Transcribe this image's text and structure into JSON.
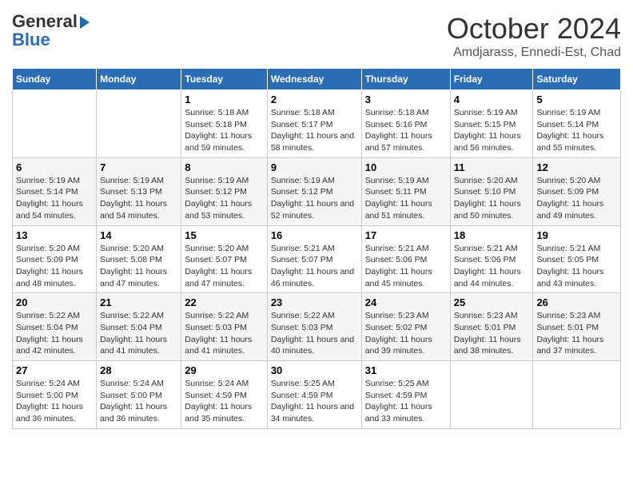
{
  "header": {
    "logo_line1": "General",
    "logo_line2": "Blue",
    "title": "October 2024",
    "subtitle": "Amdjarass, Ennedi-Est, Chad"
  },
  "calendar": {
    "headers": [
      "Sunday",
      "Monday",
      "Tuesday",
      "Wednesday",
      "Thursday",
      "Friday",
      "Saturday"
    ],
    "weeks": [
      [
        {
          "day": "",
          "detail": ""
        },
        {
          "day": "",
          "detail": ""
        },
        {
          "day": "1",
          "detail": "Sunrise: 5:18 AM\nSunset: 5:18 PM\nDaylight: 11 hours and 59 minutes."
        },
        {
          "day": "2",
          "detail": "Sunrise: 5:18 AM\nSunset: 5:17 PM\nDaylight: 11 hours and 58 minutes."
        },
        {
          "day": "3",
          "detail": "Sunrise: 5:18 AM\nSunset: 5:16 PM\nDaylight: 11 hours and 57 minutes."
        },
        {
          "day": "4",
          "detail": "Sunrise: 5:19 AM\nSunset: 5:15 PM\nDaylight: 11 hours and 56 minutes."
        },
        {
          "day": "5",
          "detail": "Sunrise: 5:19 AM\nSunset: 5:14 PM\nDaylight: 11 hours and 55 minutes."
        }
      ],
      [
        {
          "day": "6",
          "detail": "Sunrise: 5:19 AM\nSunset: 5:14 PM\nDaylight: 11 hours and 54 minutes."
        },
        {
          "day": "7",
          "detail": "Sunrise: 5:19 AM\nSunset: 5:13 PM\nDaylight: 11 hours and 54 minutes."
        },
        {
          "day": "8",
          "detail": "Sunrise: 5:19 AM\nSunset: 5:12 PM\nDaylight: 11 hours and 53 minutes."
        },
        {
          "day": "9",
          "detail": "Sunrise: 5:19 AM\nSunset: 5:12 PM\nDaylight: 11 hours and 52 minutes."
        },
        {
          "day": "10",
          "detail": "Sunrise: 5:19 AM\nSunset: 5:11 PM\nDaylight: 11 hours and 51 minutes."
        },
        {
          "day": "11",
          "detail": "Sunrise: 5:20 AM\nSunset: 5:10 PM\nDaylight: 11 hours and 50 minutes."
        },
        {
          "day": "12",
          "detail": "Sunrise: 5:20 AM\nSunset: 5:09 PM\nDaylight: 11 hours and 49 minutes."
        }
      ],
      [
        {
          "day": "13",
          "detail": "Sunrise: 5:20 AM\nSunset: 5:09 PM\nDaylight: 11 hours and 48 minutes."
        },
        {
          "day": "14",
          "detail": "Sunrise: 5:20 AM\nSunset: 5:08 PM\nDaylight: 11 hours and 47 minutes."
        },
        {
          "day": "15",
          "detail": "Sunrise: 5:20 AM\nSunset: 5:07 PM\nDaylight: 11 hours and 47 minutes."
        },
        {
          "day": "16",
          "detail": "Sunrise: 5:21 AM\nSunset: 5:07 PM\nDaylight: 11 hours and 46 minutes."
        },
        {
          "day": "17",
          "detail": "Sunrise: 5:21 AM\nSunset: 5:06 PM\nDaylight: 11 hours and 45 minutes."
        },
        {
          "day": "18",
          "detail": "Sunrise: 5:21 AM\nSunset: 5:06 PM\nDaylight: 11 hours and 44 minutes."
        },
        {
          "day": "19",
          "detail": "Sunrise: 5:21 AM\nSunset: 5:05 PM\nDaylight: 11 hours and 43 minutes."
        }
      ],
      [
        {
          "day": "20",
          "detail": "Sunrise: 5:22 AM\nSunset: 5:04 PM\nDaylight: 11 hours and 42 minutes."
        },
        {
          "day": "21",
          "detail": "Sunrise: 5:22 AM\nSunset: 5:04 PM\nDaylight: 11 hours and 41 minutes."
        },
        {
          "day": "22",
          "detail": "Sunrise: 5:22 AM\nSunset: 5:03 PM\nDaylight: 11 hours and 41 minutes."
        },
        {
          "day": "23",
          "detail": "Sunrise: 5:22 AM\nSunset: 5:03 PM\nDaylight: 11 hours and 40 minutes."
        },
        {
          "day": "24",
          "detail": "Sunrise: 5:23 AM\nSunset: 5:02 PM\nDaylight: 11 hours and 39 minutes."
        },
        {
          "day": "25",
          "detail": "Sunrise: 5:23 AM\nSunset: 5:01 PM\nDaylight: 11 hours and 38 minutes."
        },
        {
          "day": "26",
          "detail": "Sunrise: 5:23 AM\nSunset: 5:01 PM\nDaylight: 11 hours and 37 minutes."
        }
      ],
      [
        {
          "day": "27",
          "detail": "Sunrise: 5:24 AM\nSunset: 5:00 PM\nDaylight: 11 hours and 36 minutes."
        },
        {
          "day": "28",
          "detail": "Sunrise: 5:24 AM\nSunset: 5:00 PM\nDaylight: 11 hours and 36 minutes."
        },
        {
          "day": "29",
          "detail": "Sunrise: 5:24 AM\nSunset: 4:59 PM\nDaylight: 11 hours and 35 minutes."
        },
        {
          "day": "30",
          "detail": "Sunrise: 5:25 AM\nSunset: 4:59 PM\nDaylight: 11 hours and 34 minutes."
        },
        {
          "day": "31",
          "detail": "Sunrise: 5:25 AM\nSunset: 4:59 PM\nDaylight: 11 hours and 33 minutes."
        },
        {
          "day": "",
          "detail": ""
        },
        {
          "day": "",
          "detail": ""
        }
      ]
    ]
  }
}
